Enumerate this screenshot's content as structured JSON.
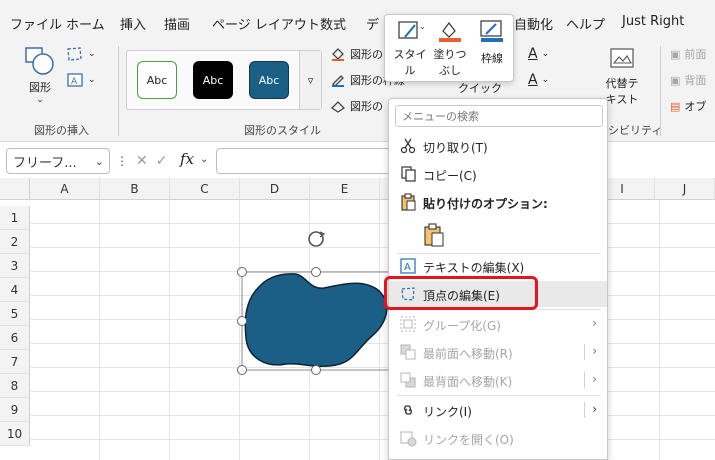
{
  "ribbon": {
    "tabs": [
      "ファイル",
      "ホーム",
      "挿入",
      "描画",
      "ページ レイアウト",
      "数式",
      "デ",
      "自動化",
      "ヘルプ",
      "Just Right"
    ],
    "insert_shape": {
      "shape_label": "図形",
      "group_label": "図形の挿入"
    },
    "shape_styles": {
      "styles": [
        "Abc",
        "Abc",
        "Abc"
      ],
      "fill_label": "図形の",
      "outline_label": "図形の枠線",
      "effects_label": "図形の",
      "group_label": "図形のスタイル"
    },
    "quick_label": "クイック",
    "alt_text": {
      "line1": "代替テ",
      "line2": "キスト"
    },
    "accessibility_label": "シビリティ",
    "arrange": {
      "bring_forward": "前面",
      "send_backward": "背面",
      "objects_pane": "オブ"
    }
  },
  "mini_toolbar": {
    "style_label_1": "スタイ",
    "style_label_2": "ル",
    "fill_label_1": "塗りつ",
    "fill_label_2": "ぶし",
    "outline_label": "枠線"
  },
  "formula_bar": {
    "name_box": "フリーフ...",
    "fx": "fx"
  },
  "grid": {
    "columns": [
      "A",
      "B",
      "C",
      "D",
      "E",
      "I",
      "J"
    ],
    "rows": [
      "1",
      "2",
      "3",
      "4",
      "5",
      "6",
      "7",
      "8",
      "9",
      "10"
    ]
  },
  "context_menu": {
    "search_placeholder": "メニューの検索",
    "cut": "切り取り(T)",
    "copy": "コピー(C)",
    "paste_options": "貼り付けのオプション:",
    "edit_text": "テキストの編集(X)",
    "edit_points": "頂点の編集(E)",
    "group": "グループ化(G)",
    "bring_to_front": "最前面へ移動(R)",
    "send_to_back": "最背面へ移動(K)",
    "link": "リンク(I)",
    "open_link": "リンクを開く(O)"
  },
  "colors": {
    "shape_fill": "#1b5e86",
    "highlight": "#e8141b",
    "fill_bar": "#e8612c",
    "outline_bar": "#1f6fb5"
  }
}
